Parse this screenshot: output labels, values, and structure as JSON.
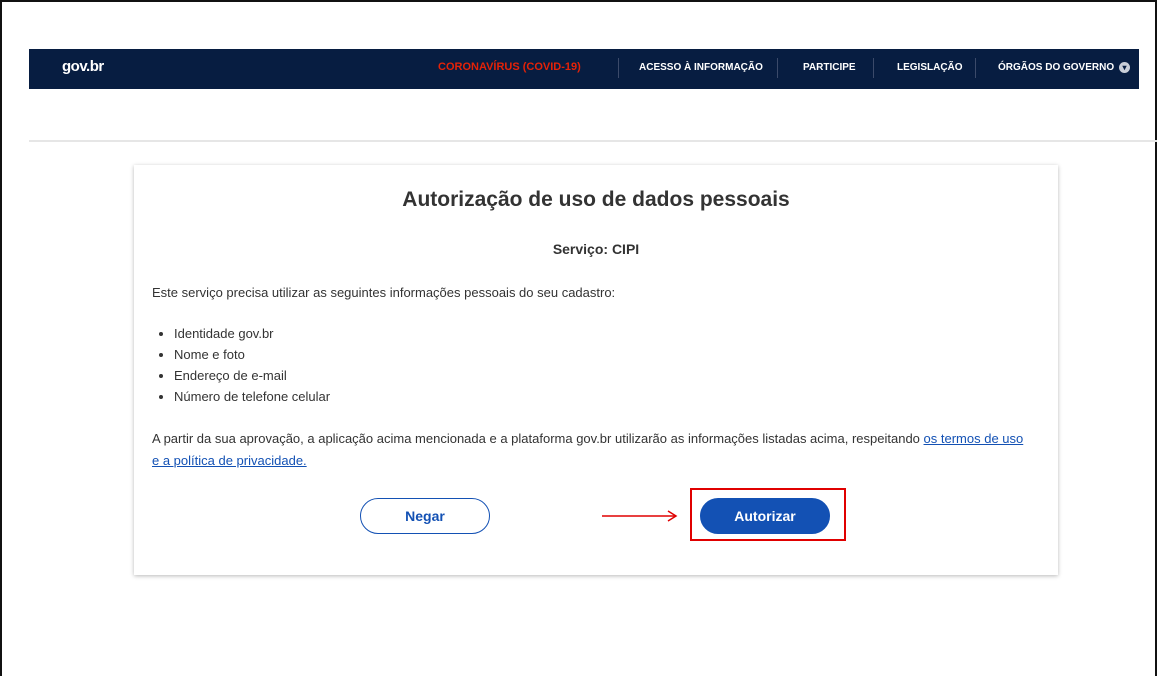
{
  "header": {
    "logo": "gov.br",
    "nav": [
      {
        "label": "CORONAVÍRUS (COVID-19)"
      },
      {
        "label": "ACESSO À INFORMAÇÃO"
      },
      {
        "label": "PARTICIPE"
      },
      {
        "label": "LEGISLAÇÃO"
      },
      {
        "label": "ÓRGÃOS DO GOVERNO"
      }
    ]
  },
  "card": {
    "title": "Autorização de uso de dados pessoais",
    "service": "Serviço: CIPI",
    "intro": "Este serviço precisa utilizar as seguintes informações pessoais do seu cadastro:",
    "items": [
      "Identidade gov.br",
      "Nome e foto",
      "Endereço de e-mail",
      "Número de telefone celular"
    ],
    "consent_text": "A partir da sua aprovação, a aplicação acima mencionada e a plataforma gov.br utilizarão as informações listadas acima, respeitando",
    "terms_link": "os termos de uso e a política de privacidade.",
    "deny_button": "Negar",
    "authorize_button": "Autorizar"
  },
  "colors": {
    "topbar": "#071d41",
    "covid": "#e52207",
    "primary": "#1351b4",
    "highlight": "#e00000"
  }
}
